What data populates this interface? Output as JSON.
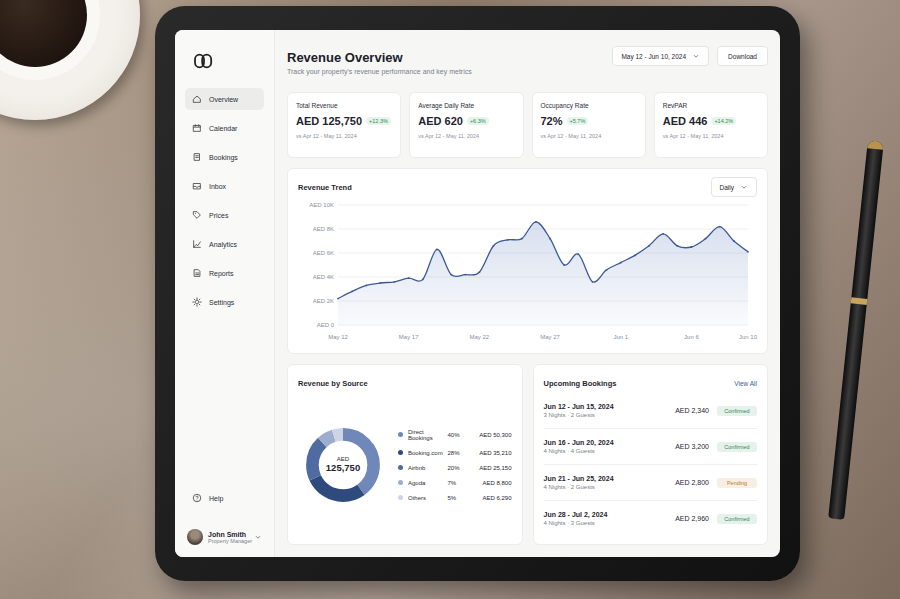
{
  "sidebar": {
    "items": [
      {
        "label": "Overview",
        "selected": true
      },
      {
        "label": "Calendar",
        "selected": false
      },
      {
        "label": "Bookings",
        "selected": false
      },
      {
        "label": "Inbox",
        "selected": false
      },
      {
        "label": "Prices",
        "selected": false
      },
      {
        "label": "Analytics",
        "selected": false
      },
      {
        "label": "Reports",
        "selected": false
      },
      {
        "label": "Settings",
        "selected": false
      }
    ],
    "help": "Help",
    "user": {
      "name": "John Smith",
      "role": "Property Manager"
    }
  },
  "header": {
    "title": "Revenue Overview",
    "subtitle": "Track your property's revenue performance and key metrics",
    "date_range": "May 12 - Jun 10, 2024",
    "download": "Download"
  },
  "kpis": [
    {
      "label": "Total Revenue",
      "value": "AED 125,750",
      "change": "+12.3%",
      "compare": "vs Apr 12 - May 11, 2024"
    },
    {
      "label": "Average Daily Rate",
      "value": "AED 620",
      "change": "+6.3%",
      "compare": "vs Apr 12 - May 11, 2024"
    },
    {
      "label": "Occupancy Rate",
      "value": "72%",
      "change": "+5.7%",
      "compare": "vs Apr 12 - May 11, 2024"
    },
    {
      "label": "RevPAR",
      "value": "AED 446",
      "change": "+14.2%",
      "compare": "vs Apr 12 - May 11, 2024"
    }
  ],
  "chart": {
    "title": "Revenue Trend",
    "interval": "Daily",
    "y_ticks": [
      "AED 10K",
      "AED 8K",
      "AED 6K",
      "AED 4K",
      "AED 2K",
      "AED 0"
    ],
    "x_ticks": [
      "May 12",
      "May 17",
      "May 22",
      "May 27",
      "Jun 1",
      "Jun 6",
      "Jun 10"
    ],
    "series": [
      {
        "name": "Revenue",
        "values": [
          2200,
          2800,
          3300,
          3500,
          3600,
          3900,
          3800,
          6300,
          4200,
          4200,
          4400,
          6600,
          7100,
          7200,
          8600,
          7200,
          5000,
          5900,
          3600,
          4600,
          5200,
          5800,
          6600,
          7600,
          6600,
          6500,
          7200,
          8200,
          7000,
          6100
        ]
      }
    ]
  },
  "sources": {
    "title": "Revenue by Source",
    "total_label": "AED",
    "total": "125,750",
    "items": [
      {
        "name": "Direct Bookings",
        "pct": "40%",
        "amount": "AED 50,300",
        "level": 0.4,
        "color": "#6f88b9"
      },
      {
        "name": "Booking.com",
        "pct": "28%",
        "amount": "AED 35,210",
        "level": 0.28,
        "color": "#2f4a7d"
      },
      {
        "name": "Airbnb",
        "pct": "20%",
        "amount": "AED 25,150",
        "level": 0.2,
        "color": "#4f6ba2"
      },
      {
        "name": "Agoda",
        "pct": "7%",
        "amount": "AED 8,800",
        "level": 0.07,
        "color": "#9cadcd"
      },
      {
        "name": "Others",
        "pct": "5%",
        "amount": "AED 6,290",
        "level": 0.05,
        "color": "#cdd5e5"
      }
    ]
  },
  "bookings": {
    "title": "Upcoming Bookings",
    "view_all": "View All",
    "items": [
      {
        "dates": "Jun 12 - Jun 15, 2024",
        "details": "3 Nights · 2 Guests",
        "amount": "AED 2,340",
        "status": "Confirmed",
        "color": "#2e8b57"
      },
      {
        "dates": "Jun 16 - Jun 20, 2024",
        "details": "4 Nights · 4 Guests",
        "amount": "AED 3,200",
        "status": "Confirmed",
        "color": "#2e8b57"
      },
      {
        "dates": "Jun 21 - Jun 25, 2024",
        "details": "4 Nights · 2 Guests",
        "amount": "AED 2,800",
        "status": "Pending",
        "color": "#c07a1a"
      },
      {
        "dates": "Jun 28 - Jul 2, 2024",
        "details": "4 Nights · 3 Guests",
        "amount": "AED 2,960",
        "status": "Confirmed",
        "color": "#2e8b57"
      }
    ]
  }
}
